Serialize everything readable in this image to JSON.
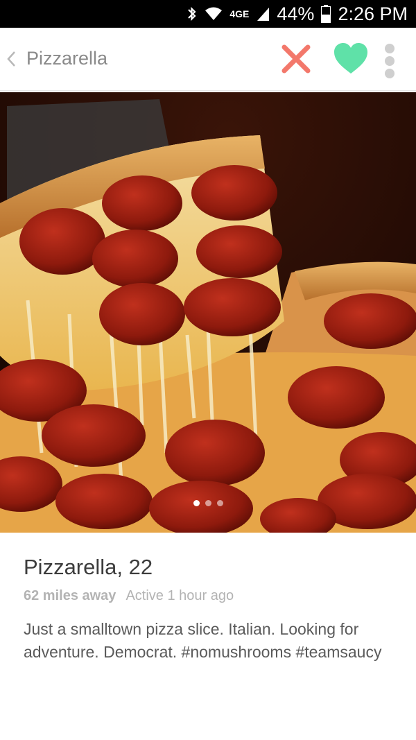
{
  "status_bar": {
    "network": "4GE",
    "battery": "44%",
    "time": "2:26 PM"
  },
  "header": {
    "title": "Pizzarella",
    "back_icon": "chevron-left-icon",
    "nope_icon": "close-icon",
    "like_icon": "heart-icon",
    "more_icon": "more-vertical-icon"
  },
  "colors": {
    "nope": "#f3786b",
    "like": "#5fe1a8",
    "more": "#cfcfcf",
    "title": "#8a8a8a"
  },
  "photo": {
    "description_icon": "pizza-photo",
    "count": 3,
    "active_index": 0
  },
  "profile": {
    "name": "Pizzarella",
    "age": "22",
    "distance": "62 miles away",
    "activity": "Active 1 hour ago",
    "bio": "Just a smalltown pizza slice. Italian. Looking for adventure.  Democrat. #nomushrooms #teamsaucy"
  }
}
